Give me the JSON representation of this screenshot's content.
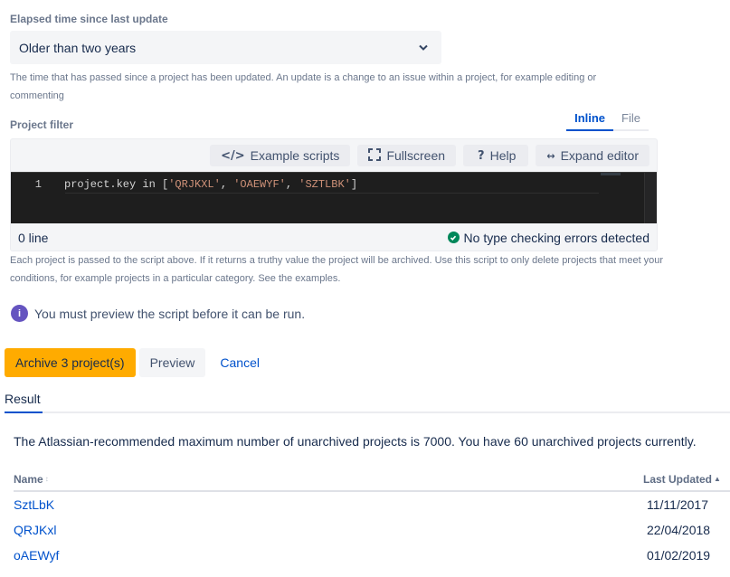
{
  "elapsed": {
    "label": "Elapsed time since last update",
    "selected": "Older than two years",
    "help": "The time that has passed since a project has been updated. An update is a change to an issue within a project, for example editing or commenting"
  },
  "filter": {
    "label": "Project filter",
    "tabs": [
      {
        "label": "Inline",
        "active": true
      },
      {
        "label": "File",
        "active": false
      }
    ],
    "toolbar": {
      "example_scripts": "Example scripts",
      "fullscreen": "Fullscreen",
      "help": "Help",
      "expand_editor": "Expand editor"
    },
    "code": {
      "line_number": "1",
      "prefix": "project.key in [",
      "strings": [
        "'QRJKXL'",
        "'OAEWYF'",
        "'SZTLBK'"
      ],
      "separator": ", ",
      "suffix": "]"
    },
    "footer": {
      "line_count": "0 line",
      "status": "No type checking errors detected",
      "status_color": "#00875a"
    },
    "help": "Each project is passed to the script above. If it returns a truthy value the project will be archived. Use this script to only delete projects that meet your conditions, for example projects in a particular category. See the examples."
  },
  "info": {
    "message": "You must preview the script before it can be run.",
    "icon_color": "#6554c0"
  },
  "actions": {
    "archive": "Archive 3 project(s)",
    "preview": "Preview",
    "cancel": "Cancel",
    "primary_color": "#ffab00"
  },
  "result": {
    "tab": "Result",
    "summary": "The Atlassian-recommended maximum number of unarchived projects is 7000. You have 60 unarchived projects currently.",
    "columns": {
      "name": "Name",
      "last_updated": "Last Updated"
    },
    "rows": [
      {
        "name": "SztLbK",
        "last_updated": "11/11/2017"
      },
      {
        "name": "QRJKxl",
        "last_updated": "22/04/2018"
      },
      {
        "name": "oAEWyf",
        "last_updated": "01/02/2019"
      }
    ]
  }
}
